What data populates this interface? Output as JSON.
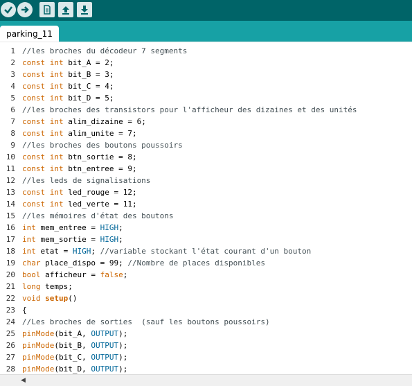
{
  "toolbar": {
    "buttons": [
      {
        "name": "verify",
        "icon": "check-icon"
      },
      {
        "name": "upload",
        "icon": "arrow-right-icon"
      },
      {
        "name": "new",
        "icon": "new-file-icon"
      },
      {
        "name": "open",
        "icon": "arrow-up-icon"
      },
      {
        "name": "save",
        "icon": "arrow-down-icon"
      }
    ]
  },
  "tab": {
    "label": "parking_11"
  },
  "colors": {
    "toolbar_bg": "#006468",
    "tabbar_bg": "#17a1a5",
    "keyword": "#cc6600",
    "constant": "#006699",
    "comment": "#434f54"
  },
  "editor": {
    "lines": [
      {
        "n": "1",
        "tokens": [
          {
            "t": "//les broches du décodeur 7 segments",
            "c": "comment"
          }
        ]
      },
      {
        "n": "2",
        "tokens": [
          {
            "t": "const int",
            "c": "kw"
          },
          {
            "t": " bit_A = 2;",
            "c": ""
          }
        ]
      },
      {
        "n": "3",
        "tokens": [
          {
            "t": "const int",
            "c": "kw"
          },
          {
            "t": " bit_B = 3;",
            "c": ""
          }
        ]
      },
      {
        "n": "4",
        "tokens": [
          {
            "t": "const int",
            "c": "kw"
          },
          {
            "t": " bit_C = 4;",
            "c": ""
          }
        ]
      },
      {
        "n": "5",
        "tokens": [
          {
            "t": "const int",
            "c": "kw"
          },
          {
            "t": " bit_D = 5;",
            "c": ""
          }
        ]
      },
      {
        "n": "6",
        "tokens": [
          {
            "t": "//les broches des transistors pour l'afficheur des dizaines et des unités",
            "c": "comment"
          }
        ]
      },
      {
        "n": "7",
        "tokens": [
          {
            "t": "const int",
            "c": "kw"
          },
          {
            "t": " alim_dizaine = 6;",
            "c": ""
          }
        ]
      },
      {
        "n": "8",
        "tokens": [
          {
            "t": "const int",
            "c": "kw"
          },
          {
            "t": " alim_unite = 7;",
            "c": ""
          }
        ]
      },
      {
        "n": "9",
        "tokens": [
          {
            "t": "//les broches des boutons poussoirs",
            "c": "comment"
          }
        ]
      },
      {
        "n": "10",
        "tokens": [
          {
            "t": "const int",
            "c": "kw"
          },
          {
            "t": " btn_sortie = 8;",
            "c": ""
          }
        ]
      },
      {
        "n": "11",
        "tokens": [
          {
            "t": "const int",
            "c": "kw"
          },
          {
            "t": " btn_entree = 9;",
            "c": ""
          }
        ]
      },
      {
        "n": "12",
        "tokens": [
          {
            "t": "//les leds de signalisations",
            "c": "comment"
          }
        ]
      },
      {
        "n": "13",
        "tokens": [
          {
            "t": "const int",
            "c": "kw"
          },
          {
            "t": " led_rouge = 12;",
            "c": ""
          }
        ]
      },
      {
        "n": "14",
        "tokens": [
          {
            "t": "const int",
            "c": "kw"
          },
          {
            "t": " led_verte = 11;",
            "c": ""
          }
        ]
      },
      {
        "n": "15",
        "tokens": [
          {
            "t": "//les mémoires d'état des boutons",
            "c": "comment"
          }
        ]
      },
      {
        "n": "16",
        "tokens": [
          {
            "t": "int",
            "c": "kw"
          },
          {
            "t": " mem_entree = ",
            "c": ""
          },
          {
            "t": "HIGH",
            "c": "const"
          },
          {
            "t": ";",
            "c": ""
          }
        ]
      },
      {
        "n": "17",
        "tokens": [
          {
            "t": "int",
            "c": "kw"
          },
          {
            "t": " mem_sortie = ",
            "c": ""
          },
          {
            "t": "HIGH",
            "c": "const"
          },
          {
            "t": ";",
            "c": ""
          }
        ]
      },
      {
        "n": "18",
        "tokens": [
          {
            "t": "int",
            "c": "kw"
          },
          {
            "t": " etat = ",
            "c": ""
          },
          {
            "t": "HIGH",
            "c": "const"
          },
          {
            "t": "; ",
            "c": ""
          },
          {
            "t": "//variable stockant l'état courant d'un bouton",
            "c": "comment"
          }
        ]
      },
      {
        "n": "19",
        "tokens": [
          {
            "t": "char",
            "c": "kw"
          },
          {
            "t": " place_dispo = 99; ",
            "c": ""
          },
          {
            "t": "//Nombre de places disponibles",
            "c": "comment"
          }
        ]
      },
      {
        "n": "20",
        "tokens": [
          {
            "t": "bool",
            "c": "kw"
          },
          {
            "t": " afficheur = ",
            "c": ""
          },
          {
            "t": "false",
            "c": "kw"
          },
          {
            "t": ";",
            "c": ""
          }
        ]
      },
      {
        "n": "21",
        "tokens": [
          {
            "t": "long",
            "c": "kw"
          },
          {
            "t": " temps;",
            "c": ""
          }
        ]
      },
      {
        "n": "22",
        "tokens": [
          {
            "t": "void",
            "c": "kw"
          },
          {
            "t": " ",
            "c": ""
          },
          {
            "t": "setup",
            "c": "fnbold"
          },
          {
            "t": "()",
            "c": ""
          }
        ]
      },
      {
        "n": "23",
        "tokens": [
          {
            "t": "{",
            "c": ""
          }
        ]
      },
      {
        "n": "24",
        "tokens": [
          {
            "t": "//Les broches de sorties  (sauf les boutons poussoirs)",
            "c": "comment"
          }
        ]
      },
      {
        "n": "25",
        "tokens": [
          {
            "t": "pinMode",
            "c": "fn"
          },
          {
            "t": "(bit_A, ",
            "c": ""
          },
          {
            "t": "OUTPUT",
            "c": "const"
          },
          {
            "t": ");",
            "c": ""
          }
        ]
      },
      {
        "n": "26",
        "tokens": [
          {
            "t": "pinMode",
            "c": "fn"
          },
          {
            "t": "(bit_B, ",
            "c": ""
          },
          {
            "t": "OUTPUT",
            "c": "const"
          },
          {
            "t": ");",
            "c": ""
          }
        ]
      },
      {
        "n": "27",
        "tokens": [
          {
            "t": "pinMode",
            "c": "fn"
          },
          {
            "t": "(bit_C, ",
            "c": ""
          },
          {
            "t": "OUTPUT",
            "c": "const"
          },
          {
            "t": ");",
            "c": ""
          }
        ]
      },
      {
        "n": "28",
        "tokens": [
          {
            "t": "pinMode",
            "c": "fn"
          },
          {
            "t": "(bit_D, ",
            "c": ""
          },
          {
            "t": "OUTPUT",
            "c": "const"
          },
          {
            "t": ");",
            "c": ""
          }
        ]
      }
    ]
  }
}
